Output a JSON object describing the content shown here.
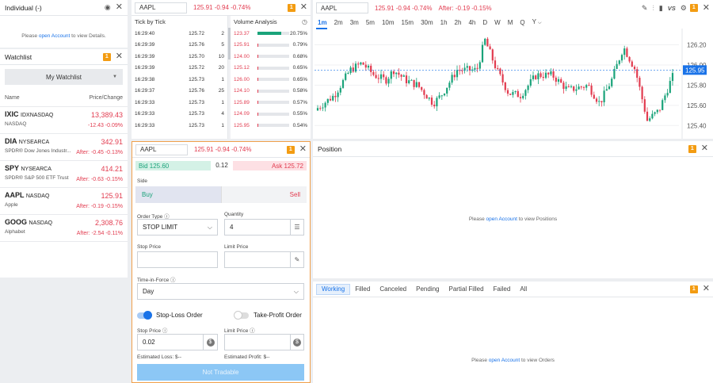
{
  "account": {
    "title": "Individual (-)",
    "msg_pre": "Please ",
    "msg_link": "open Account",
    "msg_post": " to view Details."
  },
  "watchlist": {
    "title": "Watchlist",
    "badge": "1",
    "dropdown": "My Watchlist",
    "col_name": "Name",
    "col_price": "Price/Change",
    "items": [
      {
        "symbol": "IXIC",
        "exchange": "IDXNASDAQ",
        "desc": "NASDAQ",
        "price": "13,389.43",
        "change": "-12.43  -0.09%"
      },
      {
        "symbol": "DIA",
        "exchange": "NYSEARCA",
        "desc": "SPDR® Dow Jones Industr...",
        "price": "342.91",
        "change": "After:  -0.45  -0.13%"
      },
      {
        "symbol": "SPY",
        "exchange": "NYSEARCA",
        "desc": "SPDR® S&P 500 ETF Trust",
        "price": "414.21",
        "change": "After:  -0.63  -0.15%"
      },
      {
        "symbol": "AAPL",
        "exchange": "NASDAQ",
        "desc": "Apple",
        "price": "125.91",
        "change": "After:  -0.19  -0.15%"
      },
      {
        "symbol": "GOOG",
        "exchange": "NASDAQ",
        "desc": "Alphabet",
        "price": "2,308.76",
        "change": "After:  -2.54  -0.11%"
      }
    ]
  },
  "tick": {
    "symbol": "AAPL",
    "quote": "125.91  -0.94  -0.74%",
    "badge": "1",
    "tick_title": "Tick by Tick",
    "volume_title": "Volume Analysis",
    "rows": [
      {
        "time": "16:29:40",
        "price": "125.72",
        "qty": "2"
      },
      {
        "time": "16:29:39",
        "price": "125.76",
        "qty": "5"
      },
      {
        "time": "16:29:39",
        "price": "125.70",
        "qty": "10"
      },
      {
        "time": "16:29:39",
        "price": "125.72",
        "qty": "20"
      },
      {
        "time": "16:29:38",
        "price": "125.73",
        "qty": "1"
      },
      {
        "time": "16:29:37",
        "price": "125.76",
        "qty": "25"
      },
      {
        "time": "16:29:33",
        "price": "125.73",
        "qty": "1"
      },
      {
        "time": "16:29:33",
        "price": "125.73",
        "qty": "4"
      },
      {
        "time": "16:29:33",
        "price": "125.73",
        "qty": "1"
      }
    ],
    "volume": [
      {
        "price": "123.37",
        "pct": "20.75%",
        "ratio": 0.75,
        "color": "#1aa37a"
      },
      {
        "price": "125.91",
        "pct": "0.79%",
        "ratio": 0.03,
        "color": "#e23b4f"
      },
      {
        "price": "124.00",
        "pct": "0.68%",
        "ratio": 0.03,
        "color": "#e23b4f"
      },
      {
        "price": "125.12",
        "pct": "0.65%",
        "ratio": 0.03,
        "color": "#e23b4f"
      },
      {
        "price": "126.00",
        "pct": "0.65%",
        "ratio": 0.03,
        "color": "#e23b4f"
      },
      {
        "price": "124.10",
        "pct": "0.58%",
        "ratio": 0.03,
        "color": "#e23b4f"
      },
      {
        "price": "125.89",
        "pct": "0.57%",
        "ratio": 0.03,
        "color": "#e23b4f"
      },
      {
        "price": "124.09",
        "pct": "0.55%",
        "ratio": 0.03,
        "color": "#e23b4f"
      },
      {
        "price": "125.95",
        "pct": "0.54%",
        "ratio": 0.03,
        "color": "#e23b4f"
      }
    ]
  },
  "chart": {
    "symbol": "AAPL",
    "quote": "125.91  -0.94  -0.74%",
    "after": "After:  -0.19  -0.15%",
    "badge": "1",
    "timeframes": [
      "1m",
      "2m",
      "3m",
      "5m",
      "10m",
      "15m",
      "30m",
      "1h",
      "2h",
      "4h",
      "D",
      "W",
      "M",
      "Q",
      "Y"
    ],
    "vs_label": "VS",
    "price_tag": "125.95"
  },
  "chart_data": {
    "type": "candlestick",
    "y_ticks": [
      126.2,
      126.0,
      125.8,
      125.6,
      125.4
    ],
    "ylim": [
      125.3,
      126.33
    ],
    "last_price": 125.95,
    "up_color": "#1aa37a",
    "down_color": "#e23b4f"
  },
  "order": {
    "symbol": "AAPL",
    "quote": "125.91  -0.94  -0.74%",
    "badge": "1",
    "bid": "Bid  125.60",
    "spread": "0.12",
    "ask": "Ask  125.72",
    "side_label": "Side",
    "buy": "Buy",
    "sell": "Sell",
    "order_type_label": "Order Type",
    "order_type": "STOP LIMIT",
    "quantity_label": "Quantity",
    "quantity": "4",
    "stop_price_label": "Stop Price",
    "limit_price_label": "Limit Price",
    "tif_label": "Time-in-Force",
    "tif": "Day",
    "stop_loss": "Stop-Loss Order",
    "take_profit": "Take-Profit Order",
    "sl_stop_label": "Stop Price",
    "sl_stop_value": "0.02",
    "sl_limit_label": "Limit Price",
    "est_loss": "Estimated Loss: $--",
    "est_profit": "Estimated Profit: $--",
    "submit": "Not Tradable"
  },
  "position": {
    "title": "Position",
    "badge": "1",
    "msg_pre": "Please ",
    "msg_link": "open Account",
    "msg_post": " to view Positions"
  },
  "orders": {
    "badge": "1",
    "tabs": [
      "Working",
      "Filled",
      "Canceled",
      "Pending",
      "Partial Filled",
      "Failed",
      "All"
    ],
    "msg_pre": "Please ",
    "msg_link": "open Account",
    "msg_post": " to view Orders"
  },
  "colors": {
    "accent": "#1a73e8",
    "up": "#1aa37a",
    "down": "#e23b4f",
    "badge": "#f39c12",
    "order_border": "#f0a04b"
  }
}
